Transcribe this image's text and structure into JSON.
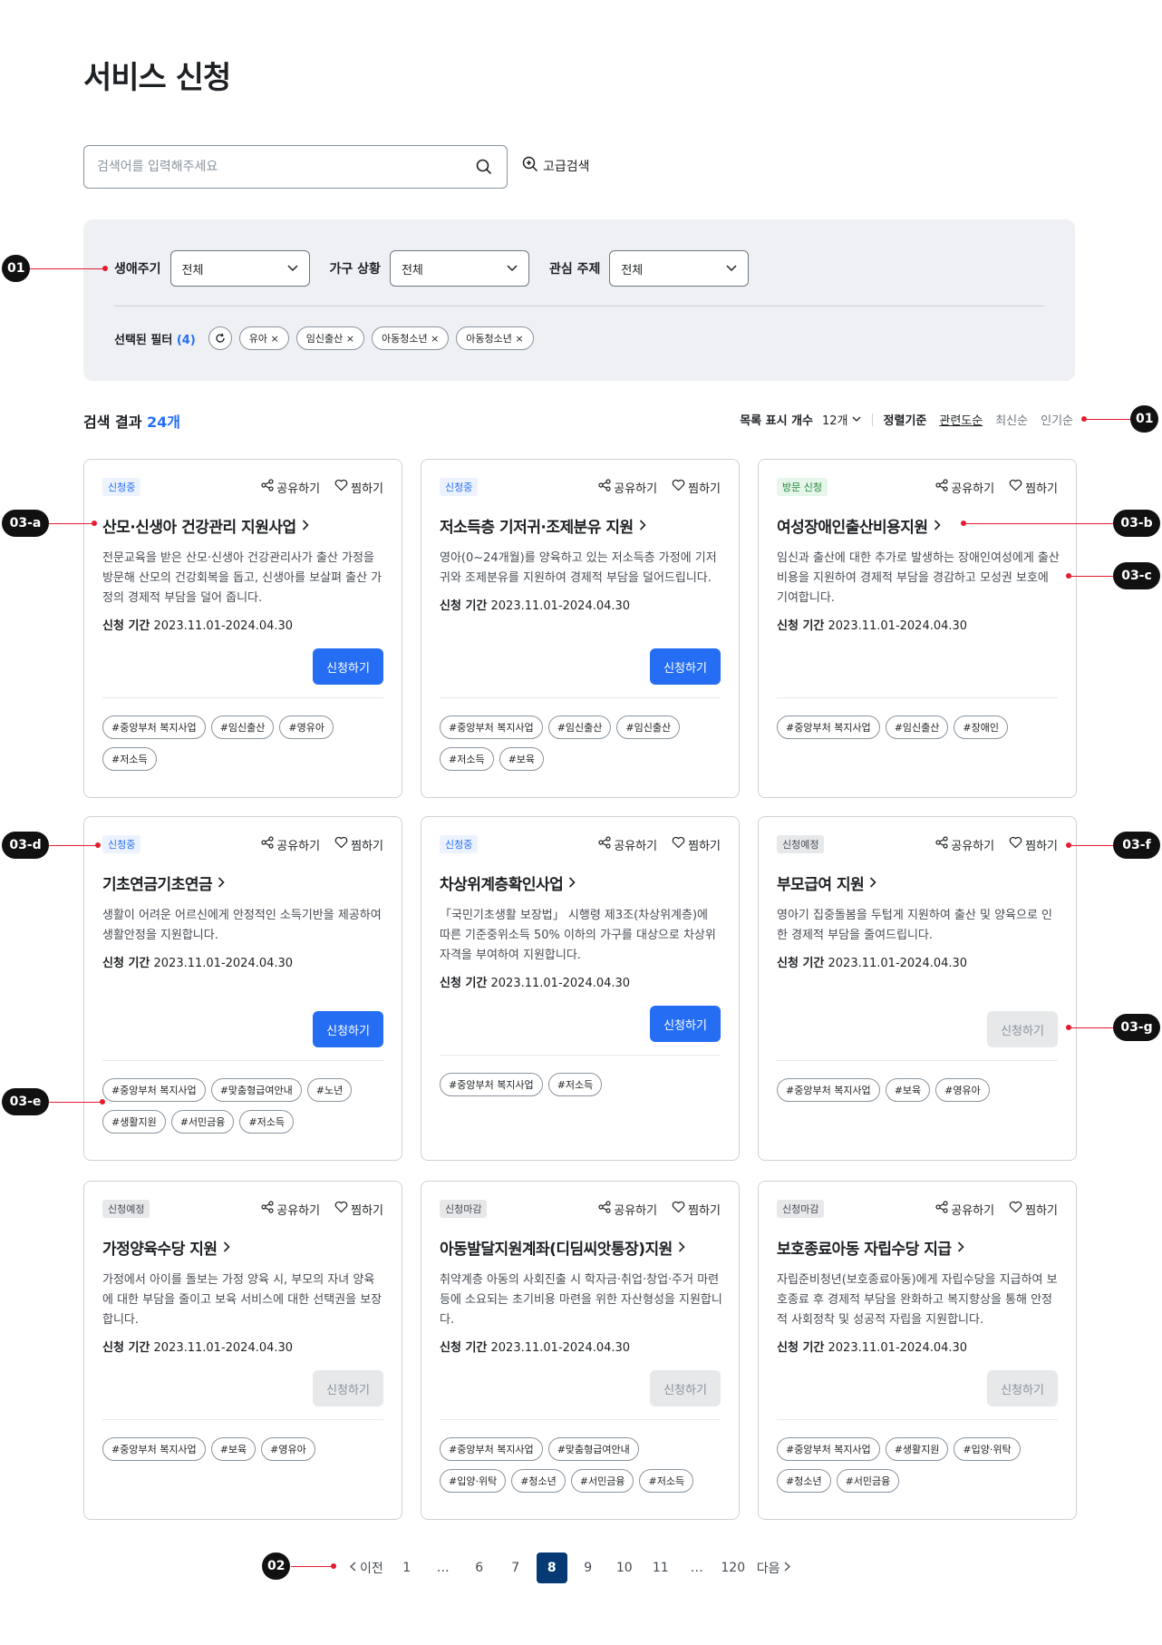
{
  "page": {
    "title": "서비스 신청"
  },
  "search": {
    "placeholder": "검색어를 입력해주세요",
    "advanced_label": "고급검색"
  },
  "filters": {
    "groups": [
      {
        "label": "생애주기",
        "value": "전체"
      },
      {
        "label": "가구 상황",
        "value": "전체"
      },
      {
        "label": "관심 주제",
        "value": "전체"
      }
    ],
    "selected_label": "선택된 필터",
    "selected_count": "(4)",
    "chips": [
      "유아 ×",
      "임신출산 ×",
      "아동청소년 ×",
      "아동청소년 ×"
    ]
  },
  "results": {
    "label": "검색 결과",
    "count": "24개",
    "per_page_label": "목록 표시 개수",
    "per_page_value": "12개",
    "sort_label": "정렬기준",
    "sort_options": [
      "관련도순",
      "최신순",
      "인기순"
    ]
  },
  "card_actions": {
    "share": "공유하기",
    "like": "찜하기",
    "period_label": "신청 기간"
  },
  "cards": [
    {
      "status": "신청중",
      "title": "산모·신생아 건강관리 지원사업",
      "desc": "전문교육을 받은 산모·신생아 건강관리사가 출산 가정을 방문해 산모의 건강회복을 돕고, 신생아를 보살펴 출산 가정의 경제적 부담을 덜어 줍니다.",
      "period": "2023.11.01-2024.04.30",
      "button": "신청하기",
      "tags": [
        "#중앙부처 복지사업",
        "#임신출산",
        "#영유아",
        "#저소득"
      ]
    },
    {
      "status": "신청중",
      "title": "저소득층 기저귀·조제분유 지원",
      "desc": "영아(0~24개월)를 양육하고 있는 저소득층 가정에 기저귀와 조제분유를 지원하여 경제적 부담을 덜어드립니다.",
      "period": "2023.11.01-2024.04.30",
      "button": "신청하기",
      "tags": [
        "#중앙부처 복지사업",
        "#임신출산",
        "#임신출산",
        "#저소득",
        "#보육"
      ]
    },
    {
      "status": "방문 신청",
      "title": "여성장애인출산비용지원",
      "desc": "임신과 출산에 대한 추가로 발생하는 장애인여성에게 출산비용을 지원하여 경제적 부담을 경감하고 모성권 보호에 기여합니다.",
      "period": "2023.11.01-2024.04.30",
      "button": "",
      "tags": [
        "#중앙부처 복지사업",
        "#임신출산",
        "#장애인"
      ]
    },
    {
      "status": "신청중",
      "title": "기초연금기초연금",
      "desc": "생활이 어려운 어르신에게 안정적인 소득기반을 제공하여 생활안정을 지원합니다.",
      "period": "2023.11.01-2024.04.30",
      "button": "신청하기",
      "tags": [
        "#중앙부처 복지사업",
        "#맞춤형급여안내",
        "#노년",
        "#생활지원",
        "#서민금융",
        "#저소득"
      ]
    },
    {
      "status": "신청중",
      "title": "차상위계층확인사업",
      "desc": "「국민기초생활 보장법」 시행령 제3조(차상위계층)에 따른 기준중위소득 50% 이하의 가구를 대상으로 차상위 자격을 부여하여 지원합니다.",
      "period": "2023.11.01-2024.04.30",
      "button": "신청하기",
      "tags": [
        "#중앙부처 복지사업",
        "#저소득"
      ]
    },
    {
      "status": "신청예정",
      "title": "부모급여 지원",
      "desc": "영아기 집중돌봄을 두텁게 지원하여 출산 및 양육으로 인한 경제적 부담을 줄여드립니다.",
      "period": "2023.11.01-2024.04.30",
      "button": "신청하기",
      "tags": [
        "#중앙부처 복지사업",
        "#보육",
        "#영유아"
      ]
    },
    {
      "status": "신청예정",
      "title": "가정양육수당 지원",
      "desc": "가정에서 아이를 돌보는 가정 양육 시, 부모의 자녀 양육에 대한 부담을 줄이고 보육 서비스에 대한 선택권을 보장합니다.",
      "period": "2023.11.01-2024.04.30",
      "button": "신청하기",
      "tags": [
        "#중앙부처 복지사업",
        "#보육",
        "#영유아"
      ]
    },
    {
      "status": "신청마감",
      "title": "아동발달지원계좌(디딤씨앗통장)지원",
      "desc": "취약계층 아동의 사회진출 시 학자금·취업·창업·주거 마련 등에 소요되는 초기비용 마련을 위한 자산형성을 지원합니다.",
      "period": "2023.11.01-2024.04.30",
      "button": "신청하기",
      "tags": [
        "#중앙부처 복지사업",
        "#맞춤형급여안내",
        "#입양·위탁",
        "#청소년",
        "#서민금융",
        "#저소득"
      ]
    },
    {
      "status": "신청마감",
      "title": "보호종료아동 자립수당 지급",
      "desc": "자립준비청년(보호종료아동)에게 자립수당을 지급하여 보호종료 후 경제적 부담을 완화하고 복지향상을 통해 안정적 사회정착 및 성공적 자립을 지원합니다.",
      "period": "2023.11.01-2024.04.30",
      "button": "신청하기",
      "tags": [
        "#중앙부처 복지사업",
        "#생활지원",
        "#입양·위탁",
        "#청소년",
        "#서민금융"
      ]
    }
  ],
  "pagination": {
    "prev": "이전",
    "next": "다음",
    "pages": [
      "1",
      "…",
      "6",
      "7",
      "8",
      "9",
      "10",
      "11",
      "…",
      "120"
    ],
    "current": "8"
  },
  "annotations": [
    "01",
    "01",
    "03-a",
    "03-b",
    "03-c",
    "03-d",
    "03-e",
    "03-f",
    "03-g",
    "02"
  ]
}
